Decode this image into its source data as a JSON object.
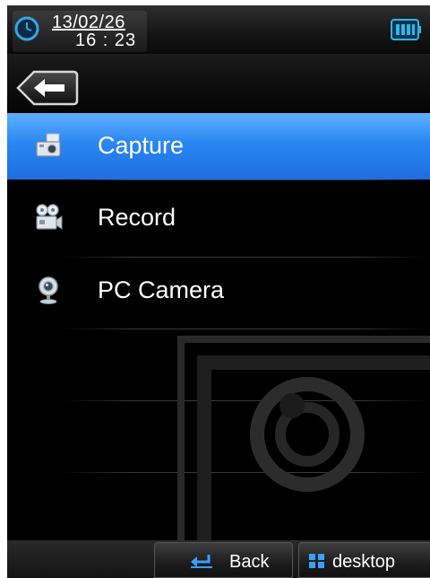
{
  "status": {
    "date": "13/02/26",
    "time": "16 : 23"
  },
  "menu": {
    "items": [
      {
        "label": "Capture",
        "icon": "camera-photo-icon",
        "selected": true
      },
      {
        "label": "Record",
        "icon": "video-camera-icon",
        "selected": false
      },
      {
        "label": "PC Camera",
        "icon": "webcam-icon",
        "selected": false
      }
    ]
  },
  "softkeys": {
    "back_label": "Back",
    "desktop_label": "desktop"
  },
  "colors": {
    "selection": "#2a86f2",
    "background": "#000000",
    "battery": "#2fb6e8"
  }
}
